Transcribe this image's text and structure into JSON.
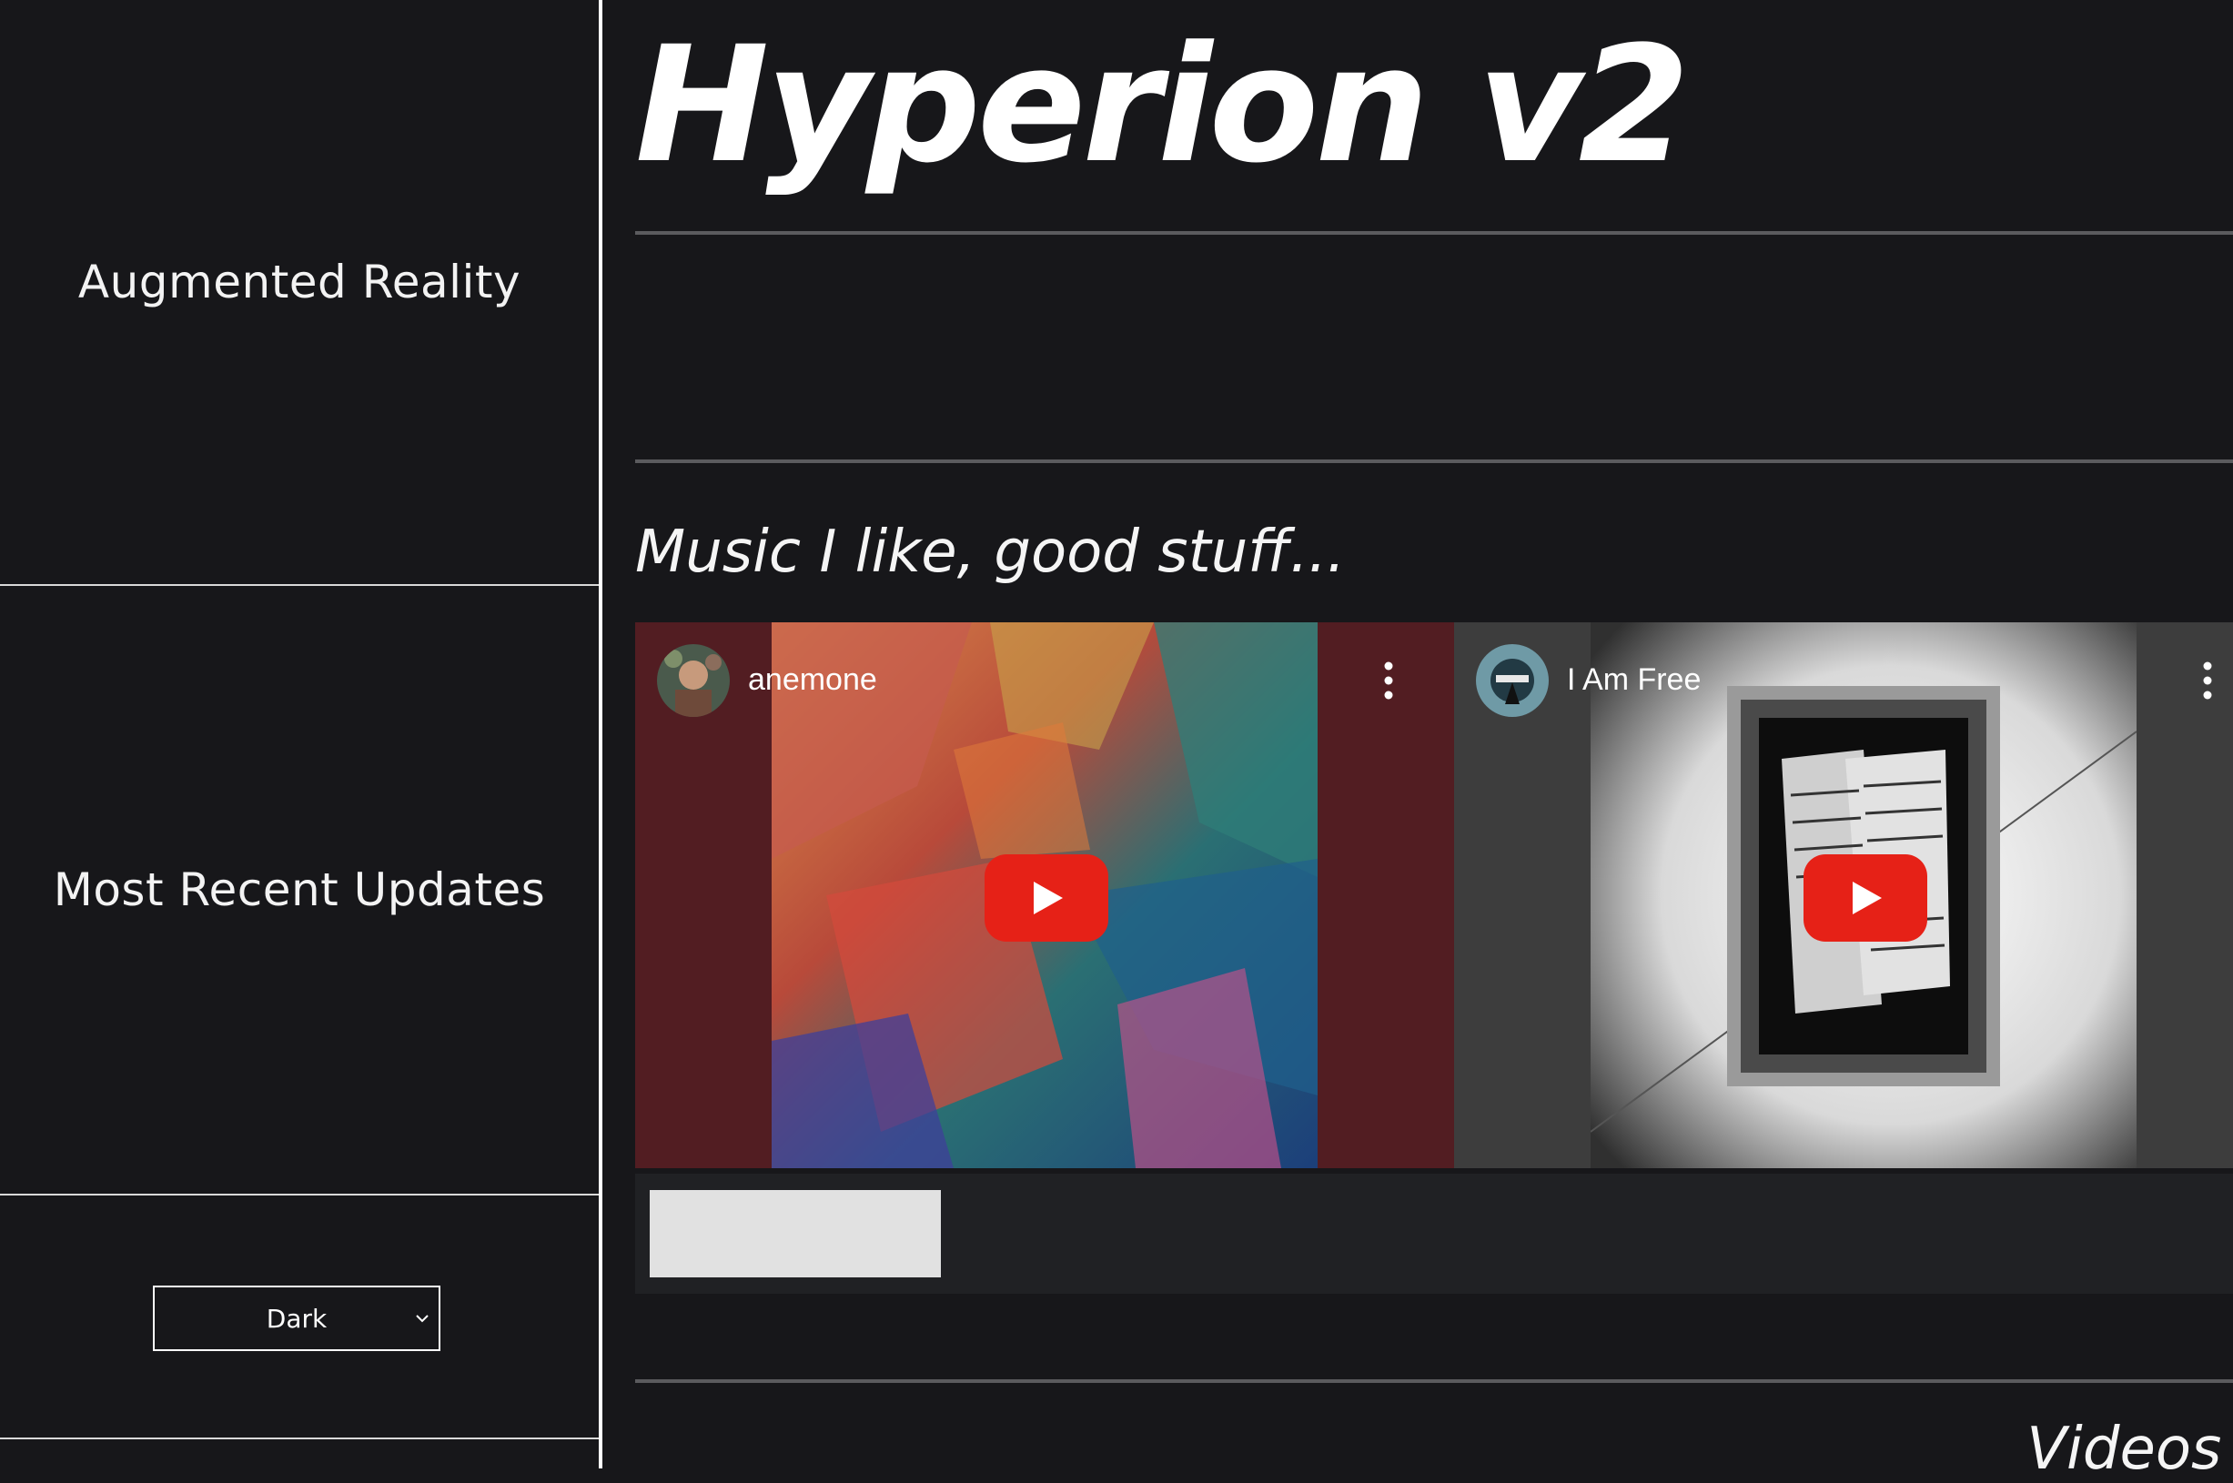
{
  "sidebar": {
    "items": [
      {
        "label": "Augmented Reality"
      },
      {
        "label": "Most Recent Updates"
      }
    ],
    "theme_select": {
      "value": "Dark"
    }
  },
  "header": {
    "title": "Hyperion v2"
  },
  "music": {
    "heading": "Music I like, good stuff...",
    "videos": [
      {
        "title": "anemone",
        "frame_color": "#521d22",
        "icon": "youtube-play-icon"
      },
      {
        "title": "I Am Free",
        "frame_color": "#3d3d3d",
        "icon": "youtube-play-icon"
      }
    ]
  },
  "next_section": {
    "heading_partial": "Videos w"
  },
  "colors": {
    "background": "#17171a",
    "divider": "#5b5b5e",
    "youtube_red": "#e62117"
  }
}
